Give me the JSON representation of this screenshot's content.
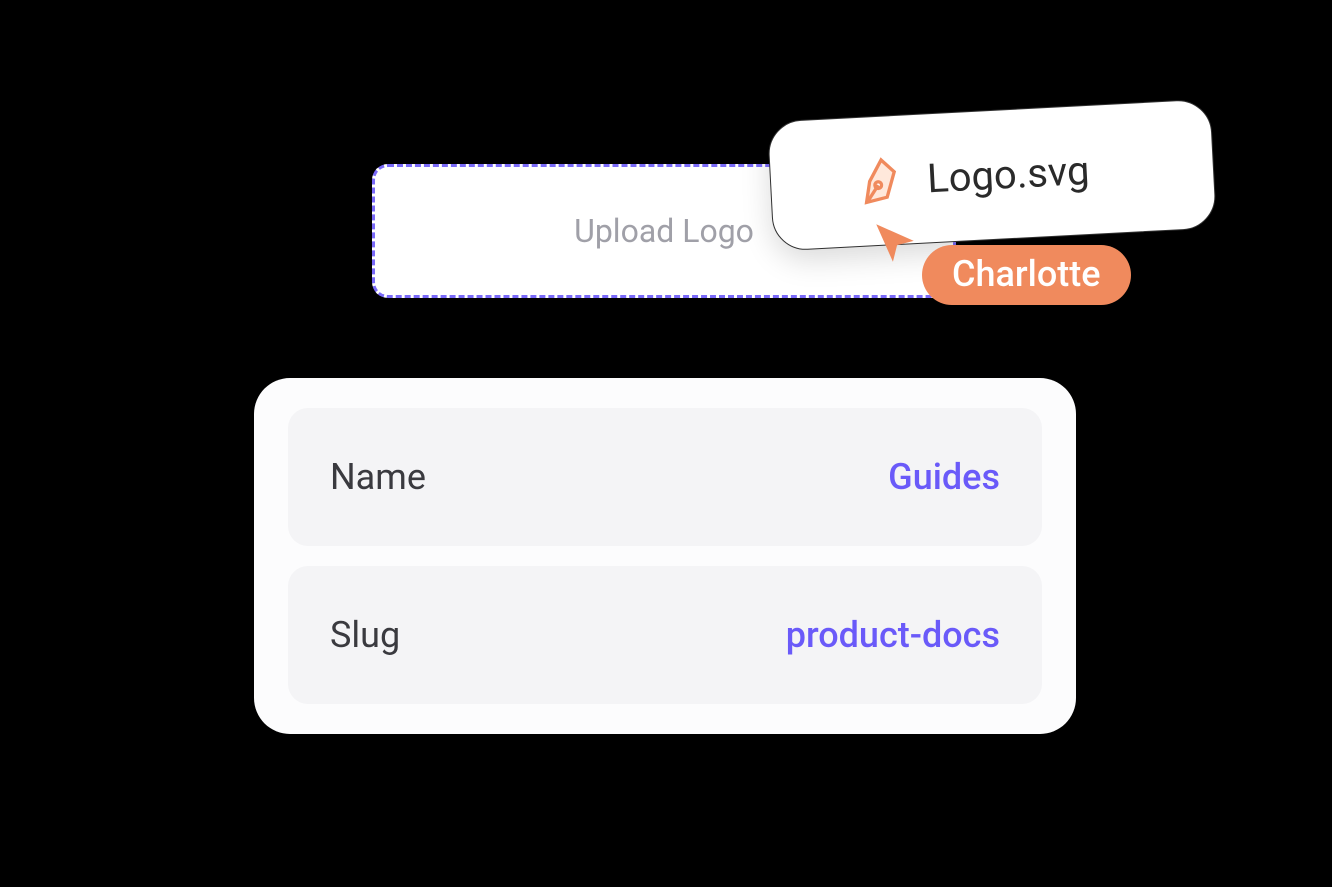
{
  "upload": {
    "placeholder": "Upload Logo"
  },
  "dragFile": {
    "fileName": "Logo.svg",
    "iconName": "pen-nib-icon"
  },
  "presence": {
    "userName": "Charlotte",
    "cursorColor": "#f08a5d"
  },
  "fields": [
    {
      "label": "Name",
      "value": "Guides"
    },
    {
      "label": "Slug",
      "value": "product-docs"
    }
  ],
  "colors": {
    "accent": "#6a5af9",
    "presence": "#f08a5d"
  }
}
